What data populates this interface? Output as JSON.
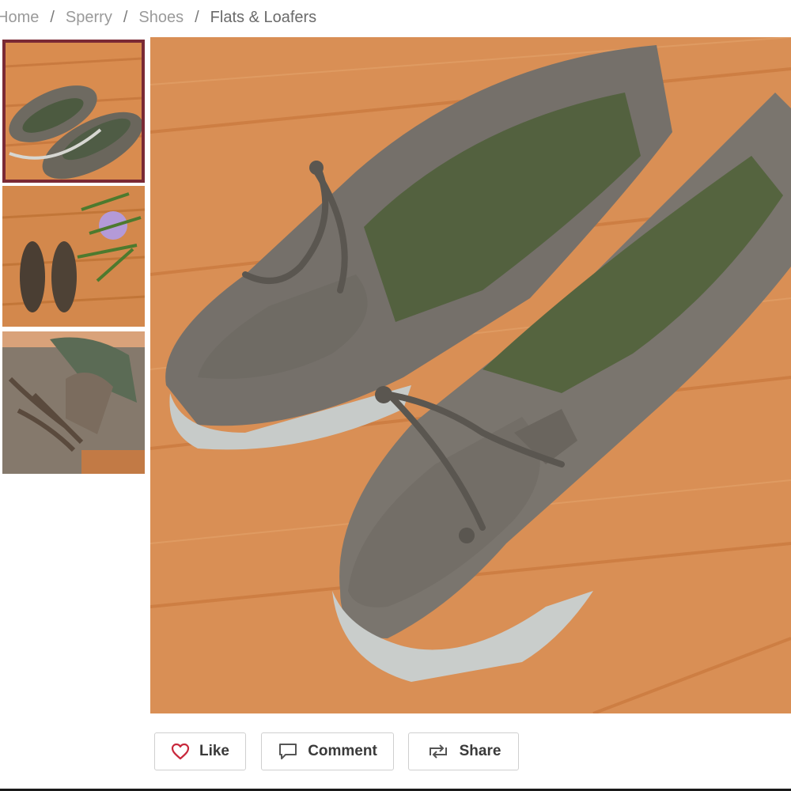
{
  "breadcrumb": {
    "items": [
      "Home",
      "Sperry",
      "Shoes",
      "Flats & Loafers"
    ],
    "separator": "/"
  },
  "gallery": {
    "thumbnails": [
      {
        "alt": "thumbnail-1",
        "selected": true
      },
      {
        "alt": "thumbnail-2",
        "selected": false
      },
      {
        "alt": "thumbnail-3",
        "selected": false
      }
    ],
    "selected_border_color": "#7a2a35"
  },
  "actions": {
    "like_label": "Like",
    "comment_label": "Comment",
    "share_label": "Share",
    "like_icon": "heart-icon",
    "comment_icon": "speech-bubble-icon",
    "share_icon": "repost-icon",
    "like_icon_color": "#c8283c"
  }
}
